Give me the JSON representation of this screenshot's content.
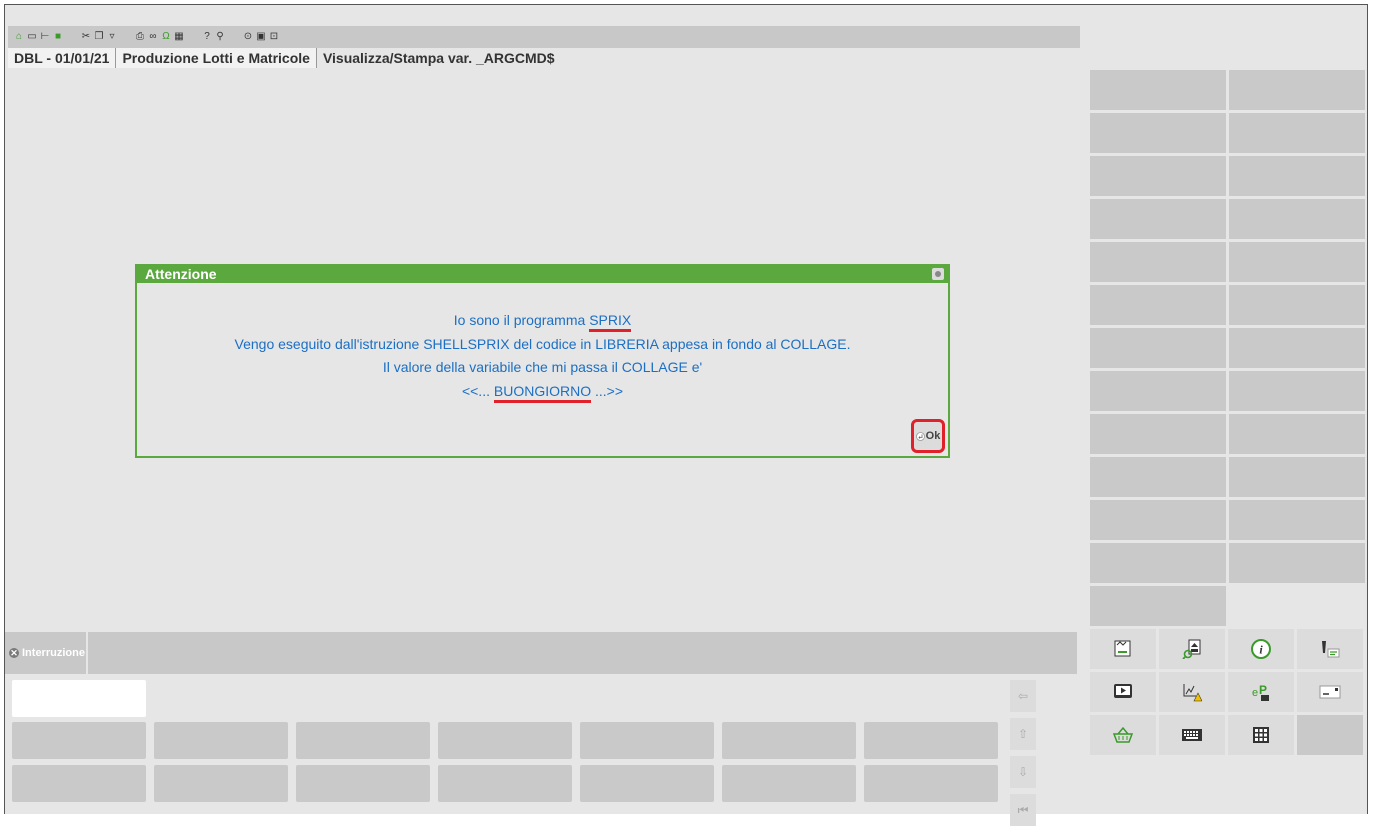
{
  "toolbar": {
    "icons": [
      "home-icon",
      "new-doc-icon",
      "tree-icon",
      "book-icon",
      "cut-icon",
      "copy-icon",
      "paste-icon",
      "print-icon",
      "link-icon",
      "omega-icon",
      "calculator-icon",
      "help-icon",
      "help-search-icon",
      "record-icon",
      "monitor-icon",
      "image-icon"
    ]
  },
  "tabs": {
    "company": "DBL - 01/01/21",
    "module": "Produzione Lotti e Matricole",
    "current": "Visualizza/Stampa var. _ARGCMD$"
  },
  "dialog": {
    "title": "Attenzione",
    "line1_prefix": "Io sono il programma ",
    "line1_highlight": "SPRIX",
    "line2": "Vengo eseguito dall'istruzione SHELLSPRIX del codice in LIBRERIA appesa in fondo al COLLAGE.",
    "line3": "Il valore della variabile che mi passa il COLLAGE e'",
    "line4_prefix": "<<... ",
    "line4_highlight": "BUONGIORNO",
    "line4_suffix": " ...>>",
    "ok_label": "Ok"
  },
  "command_bar": {
    "interrupt_label": "Interruzione"
  },
  "colors": {
    "accent_green": "#5ba83e",
    "text_blue": "#1b6fc4",
    "highlight_red": "#e0202a"
  }
}
